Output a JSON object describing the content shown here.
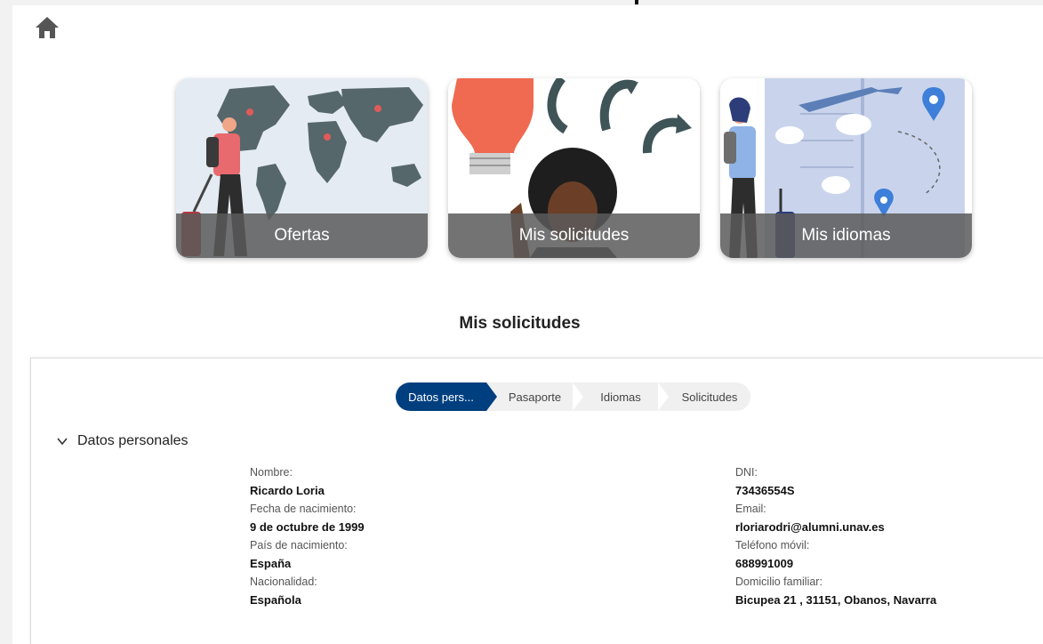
{
  "cards": [
    {
      "label": "Ofertas"
    },
    {
      "label": "Mis solicitudes"
    },
    {
      "label": "Mis idiomas"
    }
  ],
  "section_title": "Mis solicitudes",
  "stepper": [
    {
      "label": "Datos pers..."
    },
    {
      "label": "Pasaporte"
    },
    {
      "label": "Idiomas"
    },
    {
      "label": "Solicitudes"
    }
  ],
  "accordion": {
    "title": "Datos personales"
  },
  "left_fields": [
    {
      "label": "Nombre:",
      "value": "Ricardo Loria"
    },
    {
      "label": "Fecha de nacimiento:",
      "value": "9 de octubre de 1999"
    },
    {
      "label": "País de nacimiento:",
      "value": "España"
    },
    {
      "label": "Nacionalidad:",
      "value": "Española"
    }
  ],
  "right_fields": [
    {
      "label": "DNI:",
      "value": "73436554S"
    },
    {
      "label": "Email:",
      "value": "rloriarodri@alumni.unav.es"
    },
    {
      "label": "Teléfono móvil:",
      "value": "688991009"
    },
    {
      "label": "Domicilio familiar:",
      "value": "Bicupea 21 , 31151, Obanos, Navarra"
    }
  ],
  "colors": {
    "accent": "#003f7f",
    "card_band": "#5a5a5a"
  }
}
